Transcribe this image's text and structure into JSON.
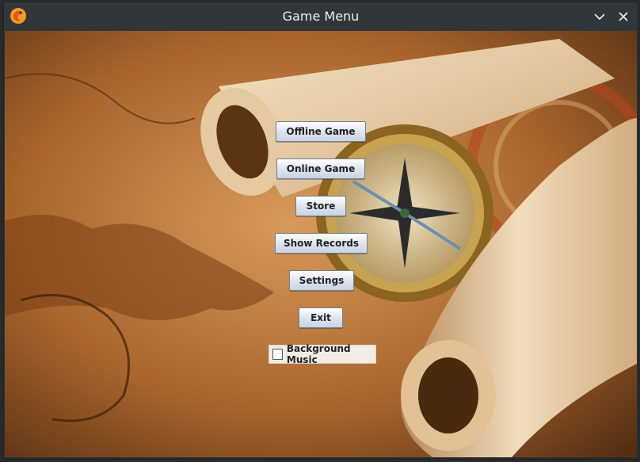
{
  "window": {
    "title": "Game Menu",
    "app_icon": "game-logo-icon",
    "minimize_icon": "chevron-down-icon",
    "close_icon": "close-icon"
  },
  "menu": {
    "buttons": [
      {
        "label": "Offline Game"
      },
      {
        "label": "Online Game"
      },
      {
        "label": "Store"
      },
      {
        "label": "Show Records"
      },
      {
        "label": "Settings"
      },
      {
        "label": "Exit"
      }
    ],
    "background_music": {
      "label": "Background Music",
      "checked": false
    }
  },
  "colors": {
    "titlebar": "#31363b",
    "button_top": "#ffffff",
    "button_bottom": "#c9d4e2",
    "map_base": "#8a4f1e"
  }
}
